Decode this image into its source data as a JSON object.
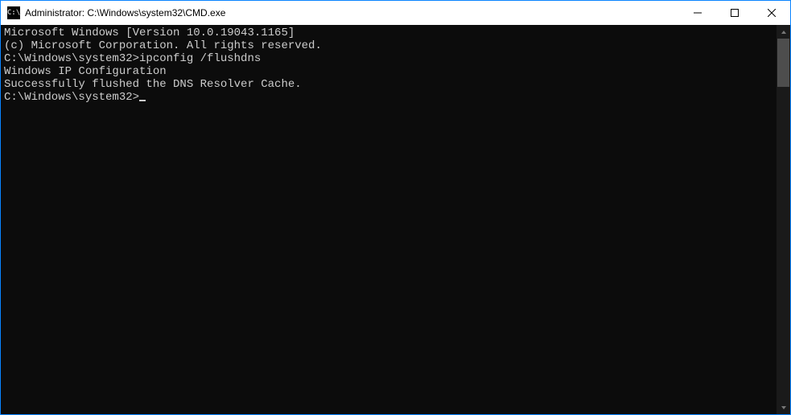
{
  "titlebar": {
    "icon_label": "C:\\",
    "title": "Administrator: C:\\Windows\\system32\\CMD.exe"
  },
  "terminal": {
    "line1": "Microsoft Windows [Version 10.0.19043.1165]",
    "line2": "(c) Microsoft Corporation. All rights reserved.",
    "blank1": "",
    "prompt1": "C:\\Windows\\system32>",
    "cmd1": "ipconfig /flushdns",
    "blank2": "",
    "line3": "Windows IP Configuration",
    "blank3": "",
    "line4": "Successfully flushed the DNS Resolver Cache.",
    "blank4": "",
    "prompt2": "C:\\Windows\\system32>"
  }
}
